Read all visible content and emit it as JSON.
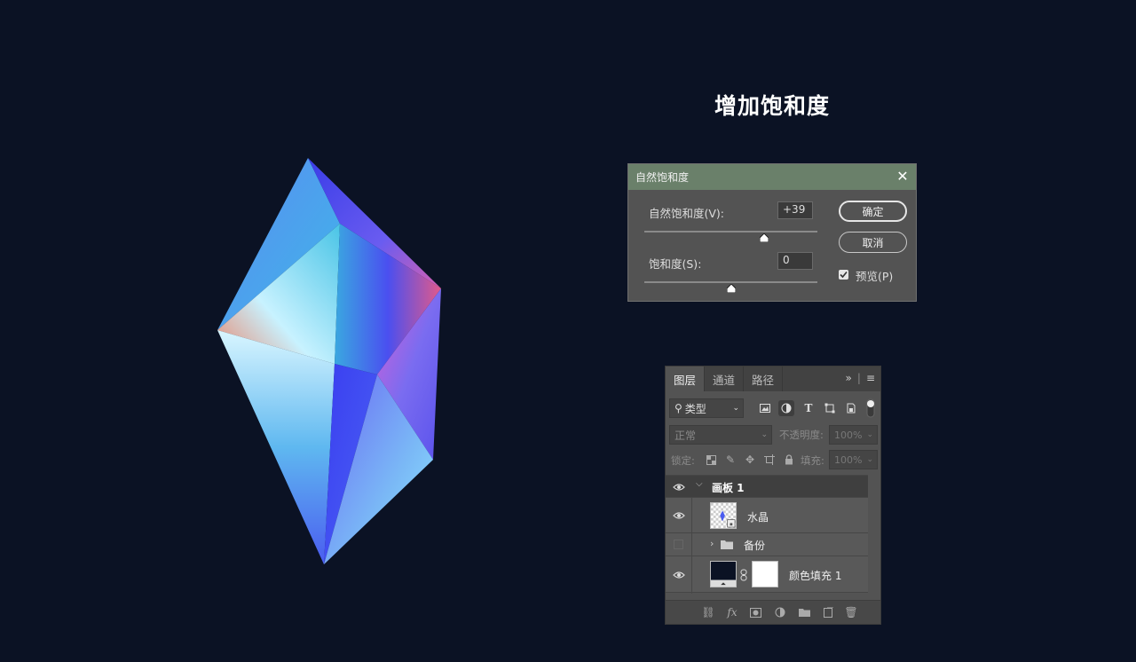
{
  "heading": "增加饱和度",
  "dialog": {
    "title": "自然饱和度",
    "vibrance_label": "自然饱和度(V):",
    "vibrance_value": "+39",
    "vibrance_level": 0.69,
    "saturation_label": "饱和度(S):",
    "saturation_value": "0",
    "saturation_level": 0.5,
    "ok_label": "确定",
    "cancel_label": "取消",
    "preview_label": "预览(P)",
    "preview_checked": true
  },
  "layers_panel": {
    "tabs": [
      "图层",
      "通道",
      "路径"
    ],
    "filter_kind": "类型",
    "blend_mode": "正常",
    "opacity_label": "不透明度:",
    "opacity_value": "100%",
    "lock_label": "锁定:",
    "fill_label": "填充:",
    "fill_value": "100%",
    "layers": [
      {
        "name": "画板 1",
        "type": "artboard",
        "visible": true
      },
      {
        "name": "水晶",
        "type": "smart-object",
        "visible": true
      },
      {
        "name": "备份",
        "type": "group",
        "visible": false
      },
      {
        "name": "颜色填充 1",
        "type": "fill",
        "visible": true
      }
    ]
  },
  "colors": {
    "background": "#0b1224",
    "dialog_title_bar": "#6a806a",
    "panel_bg": "#535353"
  }
}
